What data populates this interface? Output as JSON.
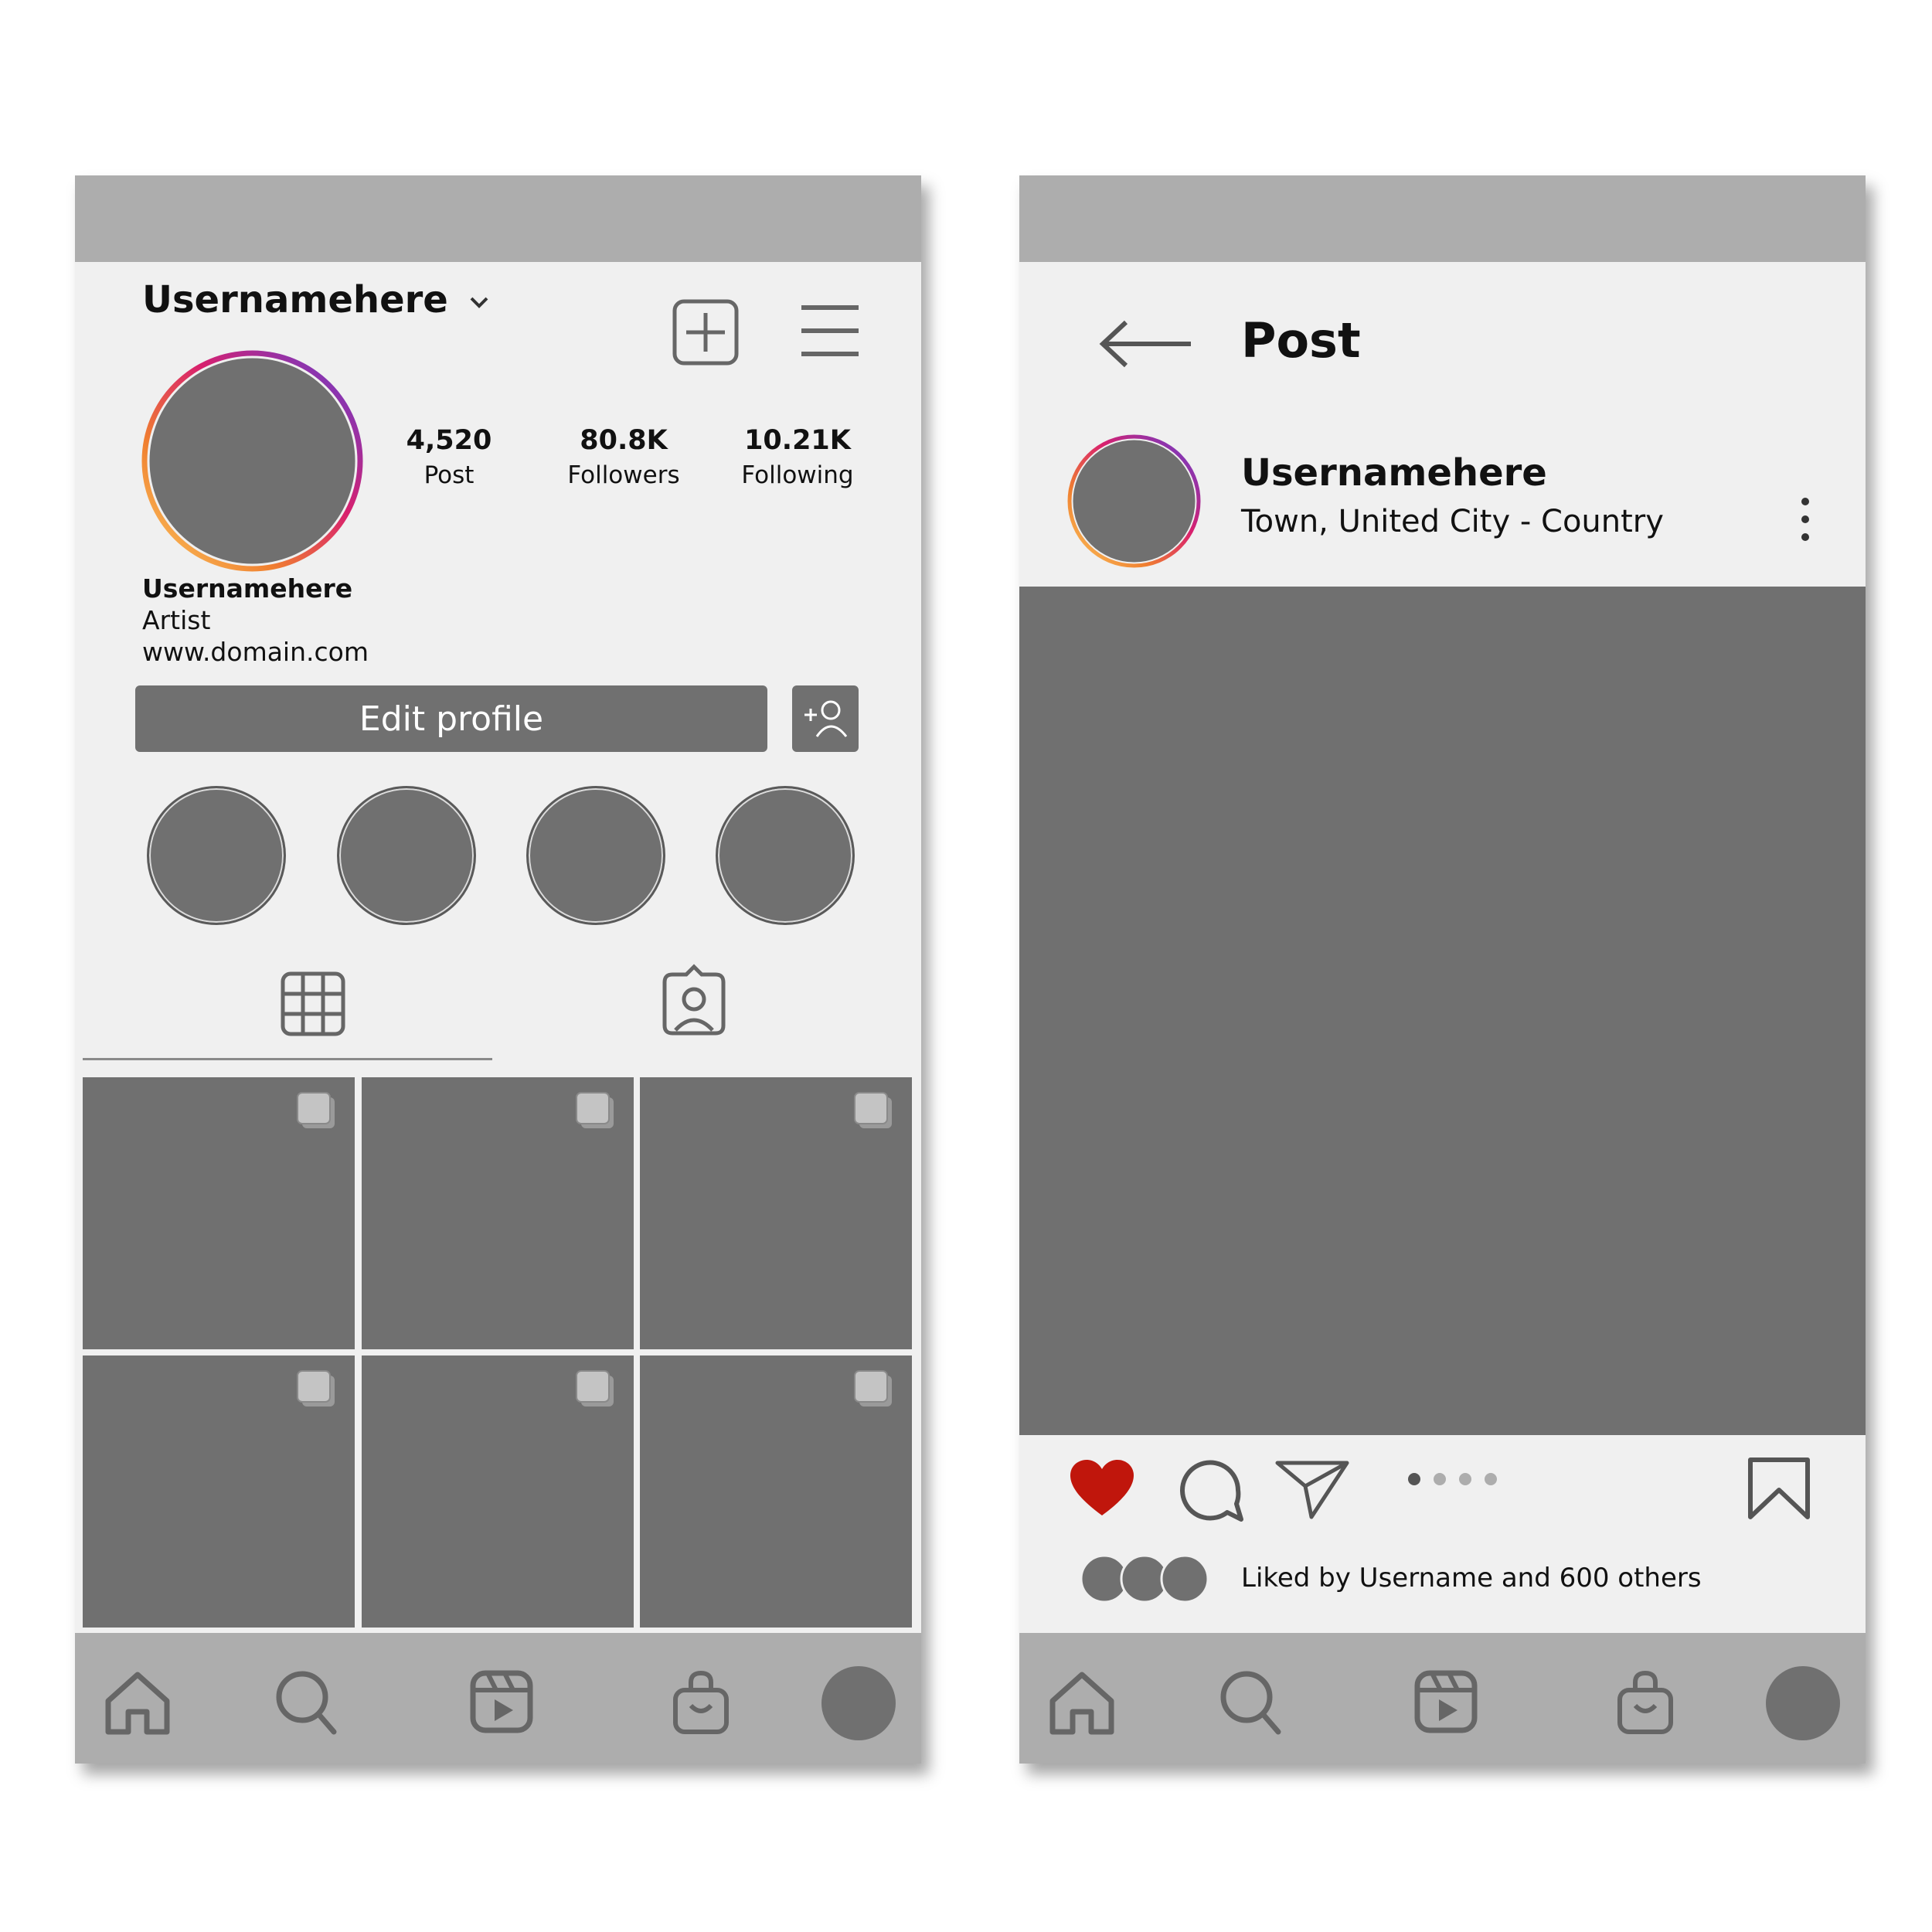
{
  "profile": {
    "username": "Usernamehere",
    "stats": [
      {
        "value": "4,520",
        "label": "Post"
      },
      {
        "value": "80.8K",
        "label": "Followers"
      },
      {
        "value": "10.21K",
        "label": "Following"
      }
    ],
    "bio": {
      "name": "Usernamehere",
      "category": "Artist",
      "website": "www.domain.com"
    },
    "edit_profile_label": "Edit profile"
  },
  "post": {
    "title": "Post",
    "username": "Usernamehere",
    "location": "Town, United City -  Country",
    "liked_by": "Liked by Username and 600 others",
    "carousel_count": 4,
    "carousel_active": 1,
    "like_color": "#c0160c"
  },
  "theme": {
    "placeholder": "#707070",
    "bar": "#adadad",
    "background": "#f0f0f0"
  }
}
